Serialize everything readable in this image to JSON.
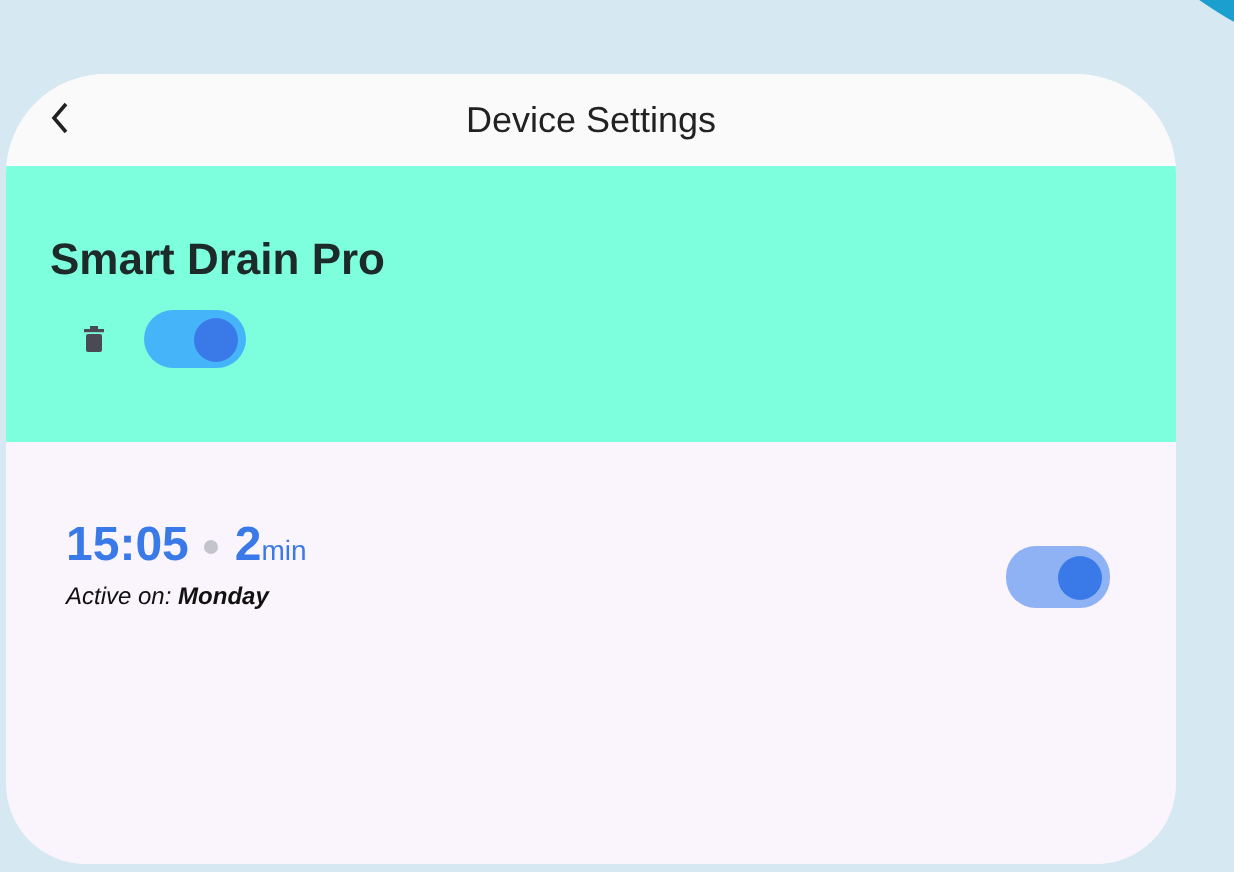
{
  "header": {
    "title": "Device Settings"
  },
  "device": {
    "name": "Smart Drain Pro",
    "enabled": true
  },
  "schedules": [
    {
      "time": "15:05",
      "duration": "2",
      "unit": "min",
      "active_on": "Active on: **Monday**",
      "enabled": true
    }
  ]
}
